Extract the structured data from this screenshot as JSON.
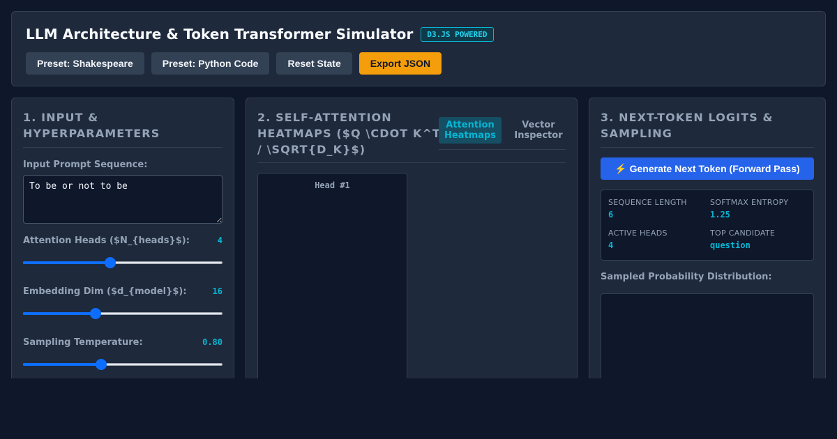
{
  "header": {
    "title": "LLM Architecture & Token Transformer Simulator",
    "badge": "D3.JS POWERED",
    "buttons": {
      "shakespeare": "Preset: Shakespeare",
      "python": "Preset: Python Code",
      "reset": "Reset State",
      "export": "Export JSON"
    }
  },
  "input_panel": {
    "title": "1. Input & Hyperparameters",
    "prompt_label": "Input Prompt Sequence:",
    "prompt_value": "To be or not to be",
    "heads_label": "Attention Heads ($N_{heads}$):",
    "heads_value": "4",
    "heads_fraction": 0.435,
    "dim_label": "Embedding Dim ($d_{model}$):",
    "dim_value": "16",
    "dim_fraction": 0.355,
    "temp_label": "Sampling Temperature:",
    "temp_value": "0.80",
    "temp_fraction": 0.385
  },
  "attention_panel": {
    "title": "2. Self-Attention Heatmaps ($Q \\cdot K^T / \\sqrt{d_k}$)",
    "tabs": [
      "Attention Heatmaps",
      "Vector Inspector"
    ],
    "head_label": "Head #1"
  },
  "logits_panel": {
    "title": "3. Next-Token Logits & Sampling",
    "generate_label": "⚡ Generate Next Token (Forward Pass)",
    "stats": {
      "seq_len_label": "Sequence Length",
      "seq_len_value": "6",
      "entropy_label": "Softmax Entropy",
      "entropy_value": "1.25",
      "heads_label": "Active Heads",
      "heads_value": "4",
      "candidate_label": "Top Candidate",
      "candidate_value": "question"
    },
    "dist_label": "Sampled Probability Distribution:"
  },
  "colors": {
    "accent": "#06b6d4",
    "primary": "#2563eb",
    "warning": "#f59e0b",
    "panel": "#1e293b",
    "background": "#0f172a"
  }
}
